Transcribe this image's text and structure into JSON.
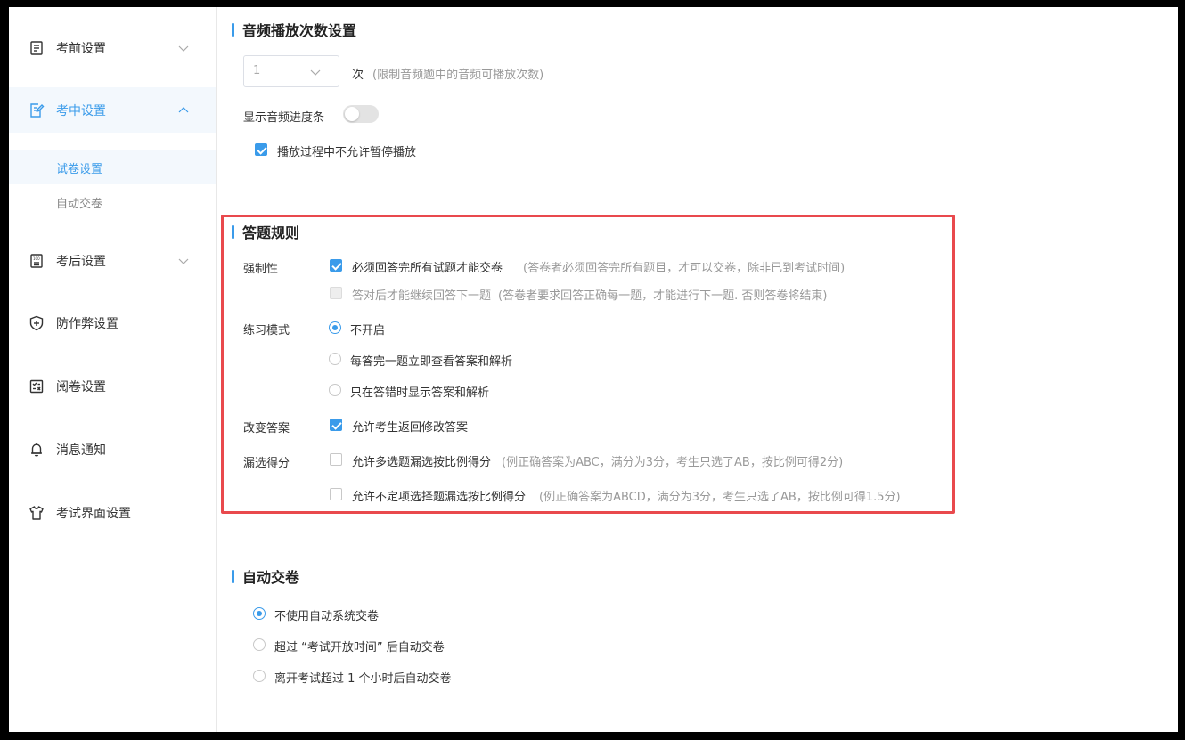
{
  "sidebar": {
    "items": [
      {
        "label": "考前设置",
        "icon": "document-icon",
        "expanded": false
      },
      {
        "label": "考中设置",
        "icon": "edit-document-icon",
        "expanded": true,
        "active": true
      },
      {
        "label": "考后设置",
        "icon": "score-icon",
        "expanded": false
      },
      {
        "label": "防作弊设置",
        "icon": "shield-icon"
      },
      {
        "label": "阅卷设置",
        "icon": "grading-icon"
      },
      {
        "label": "消息通知",
        "icon": "bell-icon"
      },
      {
        "label": "考试界面设置",
        "icon": "shirt-icon"
      }
    ],
    "subitems": [
      {
        "label": "试卷设置",
        "active": true
      },
      {
        "label": "自动交卷",
        "active": false
      }
    ]
  },
  "audio": {
    "title": "音频播放次数设置",
    "select_value": "1",
    "unit": "次",
    "hint": "(限制音频题中的音频可播放次数)",
    "progress_label": "显示音频进度条",
    "progress_enabled": false,
    "no_pause_label": "播放过程中不允许暂停播放",
    "no_pause_checked": true
  },
  "rules": {
    "title": "答题规则",
    "mandatory": {
      "label": "强制性",
      "opt1": "必须回答完所有试题才能交卷",
      "opt1_hint": "(答卷者必须回答完所有题目，才可以交卷，除非已到考试时间)",
      "opt1_checked": true,
      "opt2": "答对后才能继续回答下一题",
      "opt2_hint": "(答卷者要求回答正确每一题，才能进行下一题. 否则答卷将结束)",
      "opt2_checked": false
    },
    "practice": {
      "label": "练习模式",
      "options": [
        "不开启",
        "每答完一题立即查看答案和解析",
        "只在答错时显示答案和解析"
      ],
      "selected": 0
    },
    "change": {
      "label": "改变答案",
      "opt": "允许考生返回修改答案",
      "checked": true
    },
    "partial": {
      "label": "漏选得分",
      "opt1": "允许多选题漏选按比例得分",
      "opt1_hint": "(例正确答案为ABC，满分为3分，考生只选了AB，按比例可得2分)",
      "opt2": "允许不定项选择题漏选按比例得分",
      "opt2_hint": "(例正确答案为ABCD，满分为3分，考生只选了AB，按比例可得1.5分)"
    }
  },
  "auto_submit": {
    "title": "自动交卷",
    "options": [
      "不使用自动系统交卷",
      "超过 “考试开放时间” 后自动交卷",
      "离开考试超过 1 个小时后自动交卷"
    ],
    "selected": 0
  },
  "colors": {
    "accent": "#3a9bea",
    "highlight": "#e9494d"
  }
}
